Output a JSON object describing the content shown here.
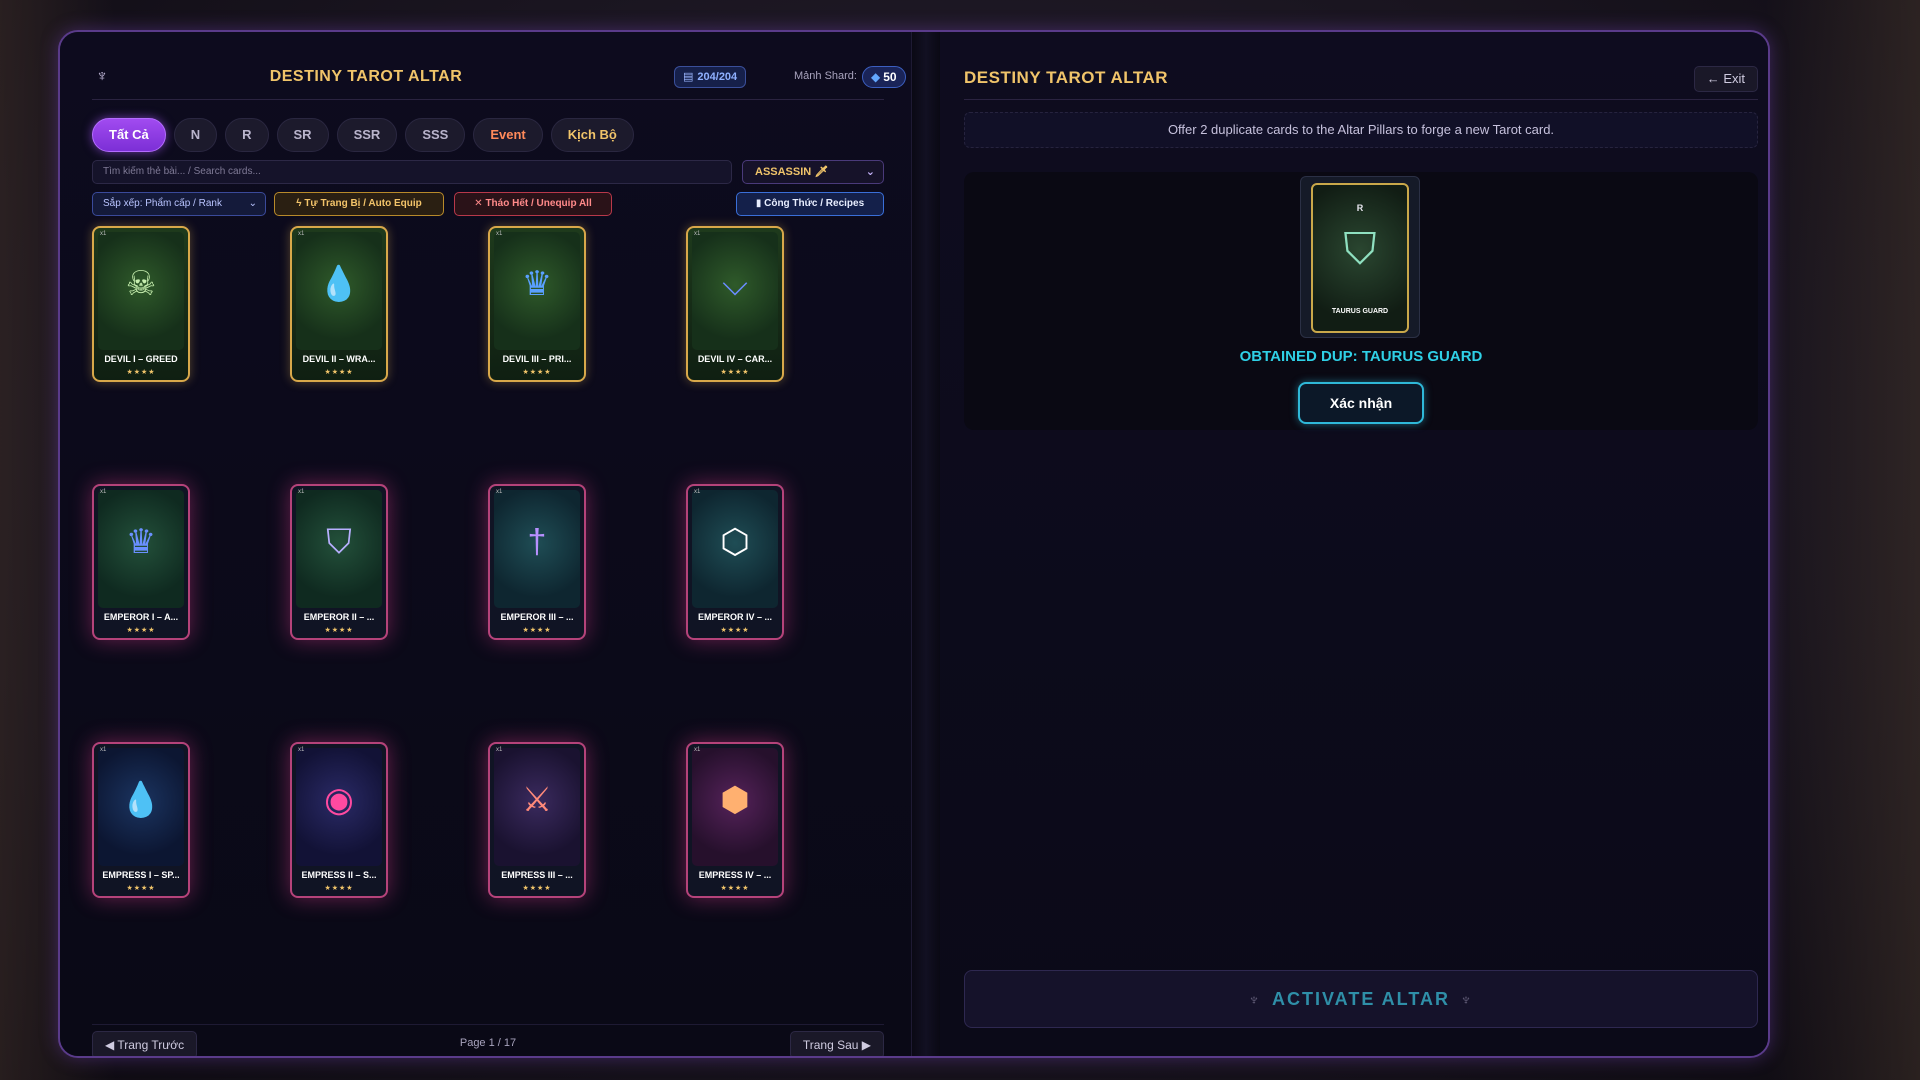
{
  "left": {
    "title": "DESTINY TAROT ALTAR",
    "capacity": "204/204",
    "shard_label": "Mảnh Shard:",
    "shard_value": "50",
    "tabs": [
      {
        "label": "Tất Cả"
      },
      {
        "label": "N"
      },
      {
        "label": "R"
      },
      {
        "label": "SR"
      },
      {
        "label": "SSR"
      },
      {
        "label": "SSS"
      },
      {
        "label": "Event"
      },
      {
        "label": "Kịch Bộ"
      }
    ],
    "search_placeholder": "Tìm kiếm thẻ bài... / Search cards...",
    "class_select": "ASSASSIN",
    "sort_select": "Sắp xếp: Phẩm cấp / Rank",
    "auto_equip": "Tự Trang Bị / Auto Equip",
    "unequip_all": "Tháo Hết / Unequip All",
    "recipes": "Công Thức / Recipes",
    "cards": [
      {
        "name": "DEVIL I – GREED",
        "stars": "★★★★",
        "glyph": "☠",
        "color": "#c8f0b0"
      },
      {
        "name": "DEVIL II – WRA...",
        "stars": "★★★★",
        "glyph": "💧",
        "color": "#4fc8b0"
      },
      {
        "name": "DEVIL III – PRI...",
        "stars": "★★★★",
        "glyph": "♛",
        "color": "#5aa0ff"
      },
      {
        "name": "DEVIL IV – CAR...",
        "stars": "★★★★",
        "glyph": "⌵",
        "color": "#6a8cff"
      },
      {
        "name": "EMPEROR I – A...",
        "stars": "★★★★",
        "glyph": "♛",
        "color": "#6a90ff"
      },
      {
        "name": "EMPEROR II – ...",
        "stars": "★★★★",
        "glyph": "⛉",
        "color": "#b8b0ff"
      },
      {
        "name": "EMPEROR III – ...",
        "stars": "★★★★",
        "glyph": "†",
        "color": "#b890ff"
      },
      {
        "name": "EMPEROR IV – ...",
        "stars": "★★★★",
        "glyph": "⬡",
        "color": "#ffffff"
      },
      {
        "name": "EMPRESS I – SP...",
        "stars": "★★★★",
        "glyph": "💧",
        "color": "#ff5aa8"
      },
      {
        "name": "EMPRESS II – S...",
        "stars": "★★★★",
        "glyph": "◉",
        "color": "#ff4aa0"
      },
      {
        "name": "EMPRESS III – ...",
        "stars": "★★★★",
        "glyph": "⚔",
        "color": "#ff8a7a"
      },
      {
        "name": "EMPRESS IV – ...",
        "stars": "★★★★",
        "glyph": "⬢",
        "color": "#ffb070"
      }
    ],
    "prev": "Trang Trước",
    "page_info": "Page 1 / 17",
    "next": "Trang Sau"
  },
  "right": {
    "title": "DESTINY TAROT ALTAR",
    "exit": "← Exit",
    "hint": "Offer 2 duplicate cards to the Altar Pillars to forge a new Tarot card.",
    "result_rank": "R",
    "result_name": "TAURUS GUARD",
    "obtained": "OBTAINED DUP: TAURUS GUARD",
    "confirm": "Xác nhận",
    "activate": "ACTIVATE ALTAR"
  },
  "colors": {
    "accent": "#f0c46a",
    "tab_active": "#a14bf0",
    "cyan": "#2fd0e6"
  }
}
